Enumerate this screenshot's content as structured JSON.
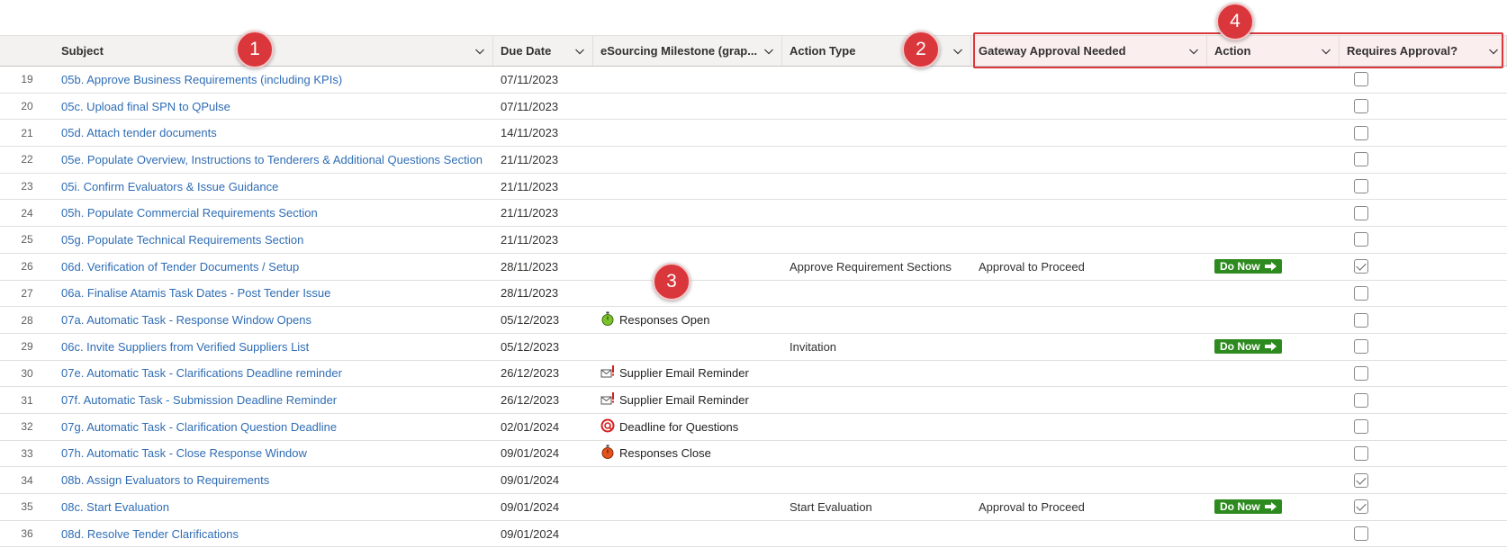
{
  "columns": {
    "subject": "Subject",
    "due_date": "Due Date",
    "milestone": "eSourcing Milestone (grap...",
    "action_type": "Action Type",
    "gateway": "Gateway Approval Needed",
    "action": "Action",
    "requires_approval": "Requires Approval?"
  },
  "callouts": [
    "1",
    "2",
    "3",
    "4"
  ],
  "do_now_label": "Do Now",
  "colors": {
    "link": "#2f6db5",
    "do_now": "#2d8a1e",
    "callout": "#d9373c"
  },
  "rows": [
    {
      "num": "19",
      "subject": "05b. Approve Business Requirements (including KPIs)",
      "due": "07/11/2023",
      "milestone": "",
      "milestone_icon": "",
      "action_type": "",
      "gateway": "",
      "action": false,
      "approval": false
    },
    {
      "num": "20",
      "subject": "05c. Upload final SPN to QPulse",
      "due": "07/11/2023",
      "milestone": "",
      "milestone_icon": "",
      "action_type": "",
      "gateway": "",
      "action": false,
      "approval": false
    },
    {
      "num": "21",
      "subject": "05d. Attach tender documents",
      "due": "14/11/2023",
      "milestone": "",
      "milestone_icon": "",
      "action_type": "",
      "gateway": "",
      "action": false,
      "approval": false
    },
    {
      "num": "22",
      "subject": "05e. Populate Overview, Instructions to Tenderers & Additional Questions Section",
      "due": "21/11/2023",
      "milestone": "",
      "milestone_icon": "",
      "action_type": "",
      "gateway": "",
      "action": false,
      "approval": false
    },
    {
      "num": "23",
      "subject": "05i. Confirm Evaluators & Issue Guidance",
      "due": "21/11/2023",
      "milestone": "",
      "milestone_icon": "",
      "action_type": "",
      "gateway": "",
      "action": false,
      "approval": false
    },
    {
      "num": "24",
      "subject": "05h. Populate Commercial Requirements Section",
      "due": "21/11/2023",
      "milestone": "",
      "milestone_icon": "",
      "action_type": "",
      "gateway": "",
      "action": false,
      "approval": false
    },
    {
      "num": "25",
      "subject": "05g. Populate Technical Requirements Section",
      "due": "21/11/2023",
      "milestone": "",
      "milestone_icon": "",
      "action_type": "",
      "gateway": "",
      "action": false,
      "approval": false
    },
    {
      "num": "26",
      "subject": "06d. Verification of Tender Documents / Setup",
      "due": "28/11/2023",
      "milestone": "",
      "milestone_icon": "",
      "action_type": "Approve Requirement Sections",
      "gateway": "Approval to Proceed",
      "action": true,
      "approval": true
    },
    {
      "num": "27",
      "subject": "06a. Finalise Atamis Task Dates - Post Tender Issue",
      "due": "28/11/2023",
      "milestone": "",
      "milestone_icon": "",
      "action_type": "",
      "gateway": "",
      "action": false,
      "approval": false
    },
    {
      "num": "28",
      "subject": "07a. Automatic Task - Response Window Opens",
      "due": "05/12/2023",
      "milestone": "Responses Open",
      "milestone_icon": "green-stopwatch-icon",
      "action_type": "",
      "gateway": "",
      "action": false,
      "approval": false
    },
    {
      "num": "29",
      "subject": "06c. Invite Suppliers from Verified Suppliers List",
      "due": "05/12/2023",
      "milestone": "",
      "milestone_icon": "",
      "action_type": "Invitation",
      "gateway": "",
      "action": true,
      "approval": false
    },
    {
      "num": "30",
      "subject": "07e. Automatic Task - Clarifications Deadline reminder",
      "due": "26/12/2023",
      "milestone": "Supplier Email Reminder",
      "milestone_icon": "email-alert-icon",
      "action_type": "",
      "gateway": "",
      "action": false,
      "approval": false
    },
    {
      "num": "31",
      "subject": "07f. Automatic Task - Submission Deadline Reminder",
      "due": "26/12/2023",
      "milestone": "Supplier Email Reminder",
      "milestone_icon": "email-alert-icon",
      "action_type": "",
      "gateway": "",
      "action": false,
      "approval": false
    },
    {
      "num": "32",
      "subject": "07g. Automatic Task - Clarification Question Deadline",
      "due": "02/01/2024",
      "milestone": "Deadline for Questions",
      "milestone_icon": "question-deadline-icon",
      "action_type": "",
      "gateway": "",
      "action": false,
      "approval": false
    },
    {
      "num": "33",
      "subject": "07h. Automatic Task - Close Response Window",
      "due": "09/01/2024",
      "milestone": "Responses Close",
      "milestone_icon": "red-stopwatch-icon",
      "action_type": "",
      "gateway": "",
      "action": false,
      "approval": false
    },
    {
      "num": "34",
      "subject": "08b. Assign Evaluators to Requirements",
      "due": "09/01/2024",
      "milestone": "",
      "milestone_icon": "",
      "action_type": "",
      "gateway": "",
      "action": false,
      "approval": true
    },
    {
      "num": "35",
      "subject": "08c. Start Evaluation",
      "due": "09/01/2024",
      "milestone": "",
      "milestone_icon": "",
      "action_type": "Start Evaluation",
      "gateway": "Approval to Proceed",
      "action": true,
      "approval": true
    },
    {
      "num": "36",
      "subject": "08d. Resolve Tender Clarifications",
      "due": "09/01/2024",
      "milestone": "",
      "milestone_icon": "",
      "action_type": "",
      "gateway": "",
      "action": false,
      "approval": false
    }
  ]
}
